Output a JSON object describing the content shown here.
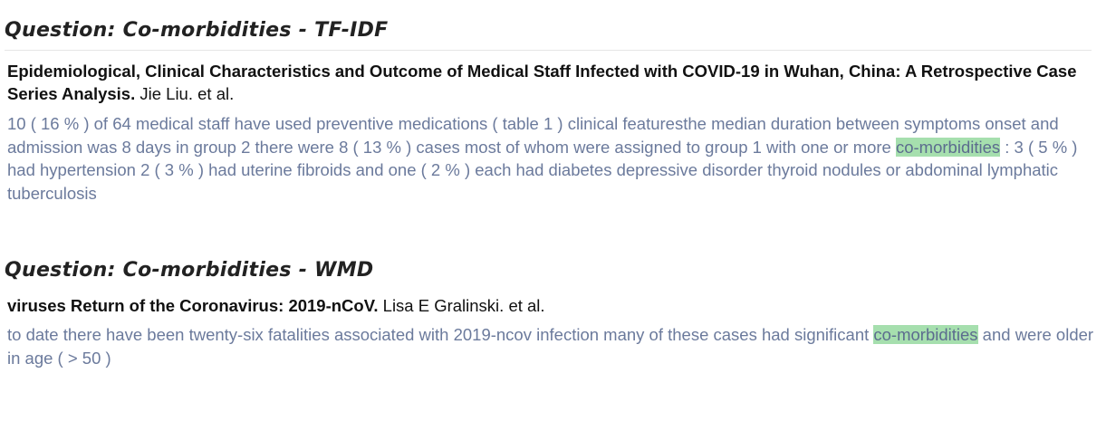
{
  "results": [
    {
      "question": "Question: Co-morbidities - TF-IDF",
      "paper_title": "Epidemiological, Clinical Characteristics and Outcome of Medical Staff Infected with COVID-19 in Wuhan, China: A Retrospective Case Series Analysis.",
      "authors": " Jie Liu. et al.",
      "excerpt_before": "10 ( 16 % ) of 64 medical staff have used preventive medications ( table 1 ) clinical featuresthe median duration between symptoms onset and admission was 8 days in group 2 there were 8 ( 13 % ) cases most of whom were assigned to group 1 with one or more ",
      "highlight": "co-morbidities",
      "excerpt_after": " : 3 ( 5 % ) had hypertension 2 ( 3 % ) had uterine fibroids and one ( 2 % ) each had diabetes depressive disorder thyroid nodules or abdominal lymphatic tuberculosis"
    },
    {
      "question": "Question: Co-morbidities - WMD",
      "paper_title": "viruses Return of the Coronavirus: 2019-nCoV.",
      "authors": " Lisa E Gralinski. et al.",
      "excerpt_before": "to date there have been twenty-six fatalities associated with 2019-ncov infection many of these cases had significant ",
      "highlight": "co-morbidities",
      "excerpt_after": " and were older in age ( > 50 )"
    }
  ],
  "colors": {
    "highlight": "#a6dfae",
    "excerpt_text": "#6b7a9c",
    "title_text": "#111111"
  }
}
